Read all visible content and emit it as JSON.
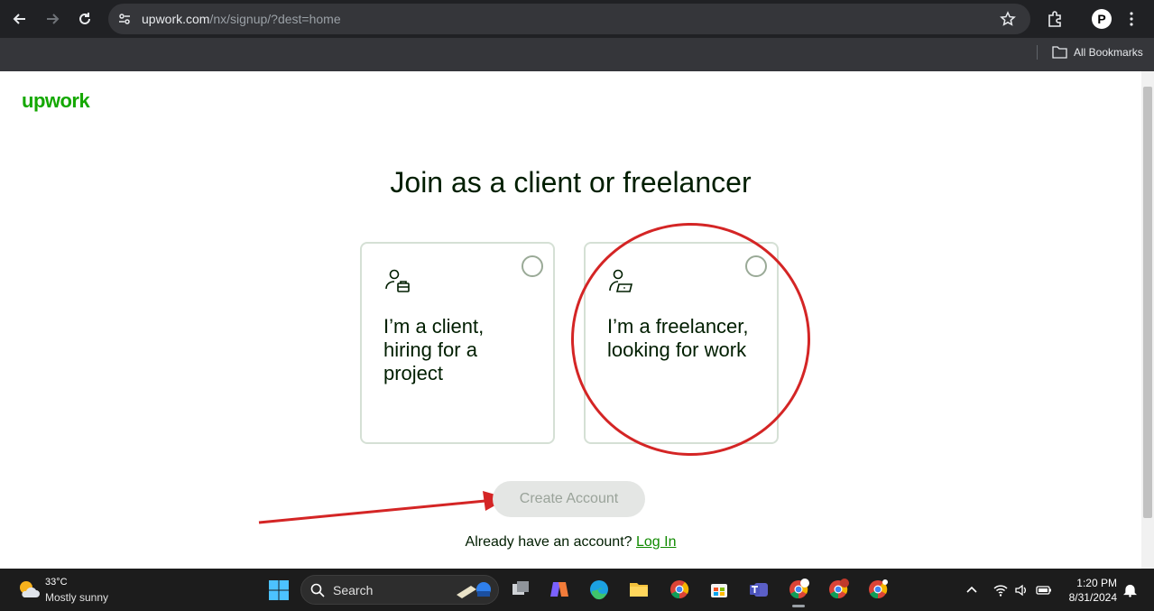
{
  "browser": {
    "url_host": "upwork.com",
    "url_path": "/nx/signup/?dest=home",
    "bookmarks_label": "All Bookmarks"
  },
  "page": {
    "logo": "upwork",
    "title": "Join as a client or freelancer",
    "cards": [
      {
        "label": "I’m a client, hiring for a project",
        "selected": false
      },
      {
        "label": "I’m a freelancer, looking for work",
        "selected": false
      }
    ],
    "create_button": "Create Account",
    "login_prompt": "Already have an account?",
    "login_link": "Log In"
  },
  "taskbar": {
    "weather_temp": "33°C",
    "weather_desc": "Mostly sunny",
    "search_label": "Search",
    "time": "1:20 PM",
    "date": "8/31/2024"
  },
  "colors": {
    "brand": "#14a800",
    "link": "#108a00",
    "annotation": "#d42525"
  }
}
